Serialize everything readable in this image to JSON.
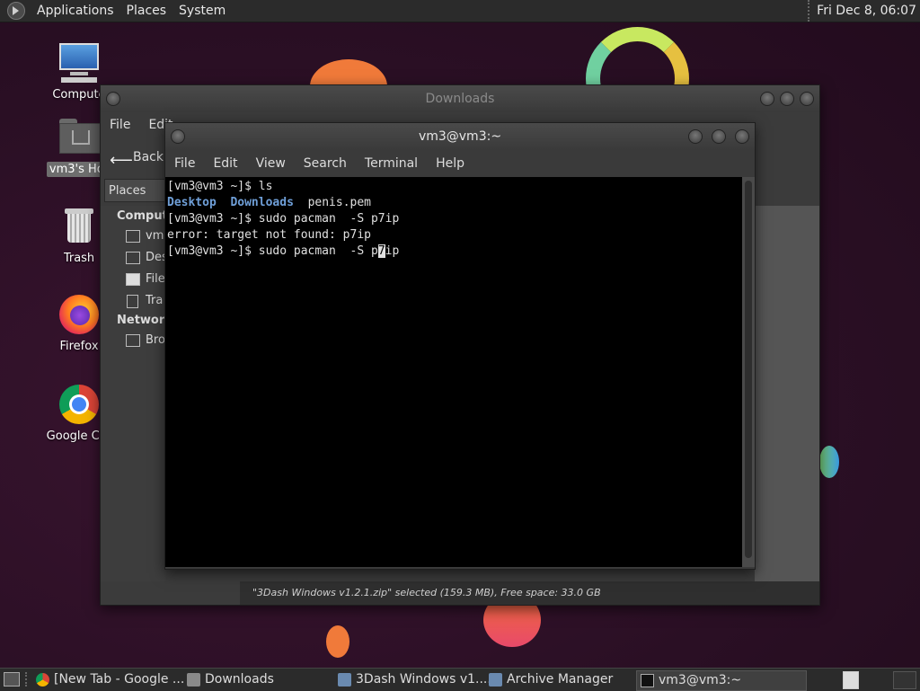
{
  "top_panel": {
    "menus": [
      "Applications",
      "Places",
      "System"
    ],
    "clock": "Fri Dec 8, 06:07"
  },
  "desktop_icons": [
    {
      "label": "Compute",
      "icon": "computer-icon"
    },
    {
      "label": "vm3's Hor",
      "icon": "home-folder-icon"
    },
    {
      "label": "Trash",
      "icon": "trash-icon"
    },
    {
      "label": "Firefox",
      "icon": "firefox-icon"
    },
    {
      "label": "Google Chr",
      "icon": "chrome-icon"
    }
  ],
  "file_manager": {
    "title": "Downloads",
    "menu": [
      "File",
      "Edit"
    ],
    "back_label": "Back",
    "places_label": "Places",
    "sidebar_section_computer": "Compute",
    "sidebar_items": [
      "vm3",
      "Des",
      "File",
      "Tra"
    ],
    "sidebar_section_network": "Network",
    "network_items": [
      "Bro"
    ],
    "status": "\"3Dash Windows v1.2.1.zip\" selected (159.3 MB), Free space: 33.0 GB"
  },
  "terminal": {
    "title": "vm3@vm3:~",
    "menu": [
      "File",
      "Edit",
      "View",
      "Search",
      "Terminal",
      "Help"
    ],
    "lines": {
      "l1": "[vm3@vm3 ~]$ ls",
      "l2_a": "Desktop",
      "l2_b": "Downloads",
      "l2_c": "penis.pem",
      "l3": "[vm3@vm3 ~]$ sudo pacman  -S p7ip",
      "l4": "error: target not found: p7ip",
      "l5_pre": "[vm3@vm3 ~]$ sudo pacman  -S p",
      "l5_cur": "7",
      "l5_post": "ip"
    }
  },
  "taskbar": {
    "tasks": [
      {
        "label": "[New Tab - Google ...",
        "icon": "chrome-icon"
      },
      {
        "label": "Downloads",
        "icon": "folder-icon"
      },
      {
        "label": "3Dash Windows v1....",
        "icon": "archive-icon"
      },
      {
        "label": "Archive Manager",
        "icon": "archive-icon"
      },
      {
        "label": "vm3@vm3:~",
        "icon": "terminal-icon"
      }
    ]
  }
}
